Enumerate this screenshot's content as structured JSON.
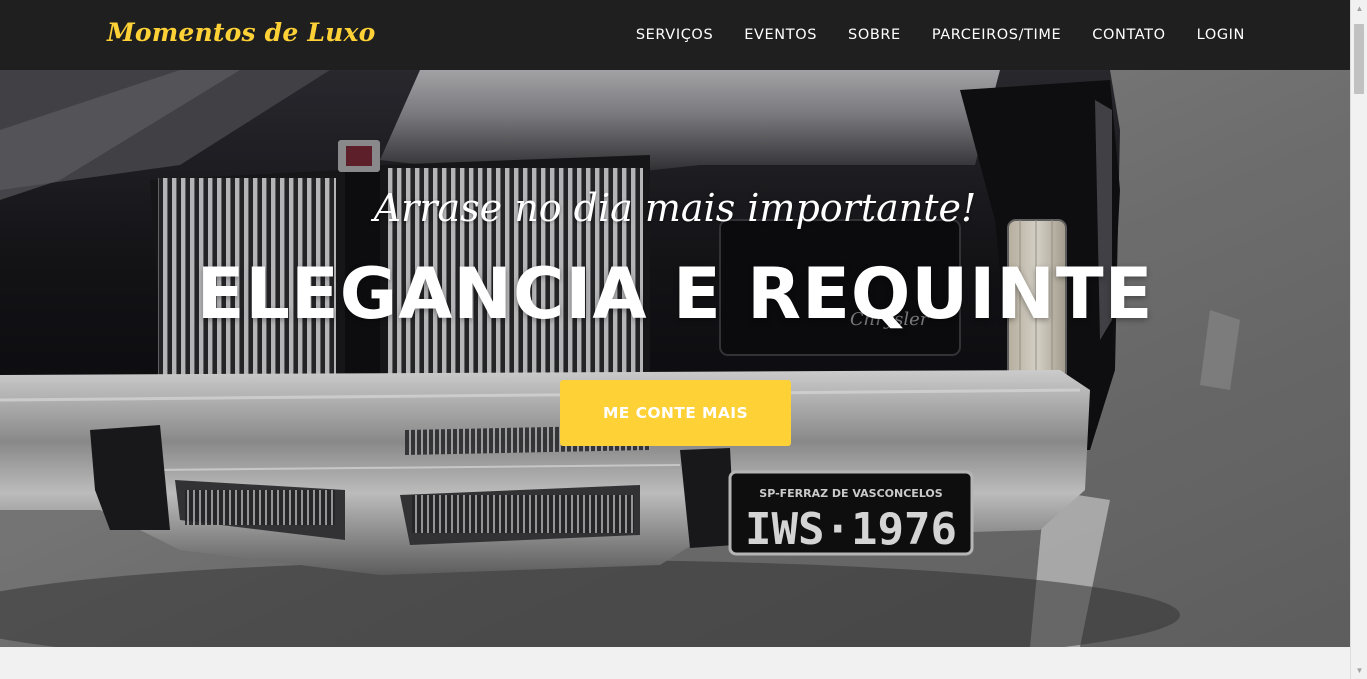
{
  "navbar": {
    "brand": "Momentos de Luxo",
    "links": [
      "SERVIÇOS",
      "EVENTOS",
      "SOBRE",
      "PARCEIROS/TIME",
      "CONTATO",
      "LOGIN"
    ]
  },
  "hero": {
    "subheading": "Arrase no dia mais importante!",
    "heading": "ELEGANCIA E REQUINTE",
    "cta_label": "ME CONTE MAIS",
    "plate_top": "SP-FERRAZ DE VASCONCELOS",
    "plate_number": "IWS·1976"
  },
  "colors": {
    "navbar_bg": "#1f1f1f",
    "brand": "#fed136",
    "cta_bg": "#fed136",
    "text": "#ffffff"
  }
}
